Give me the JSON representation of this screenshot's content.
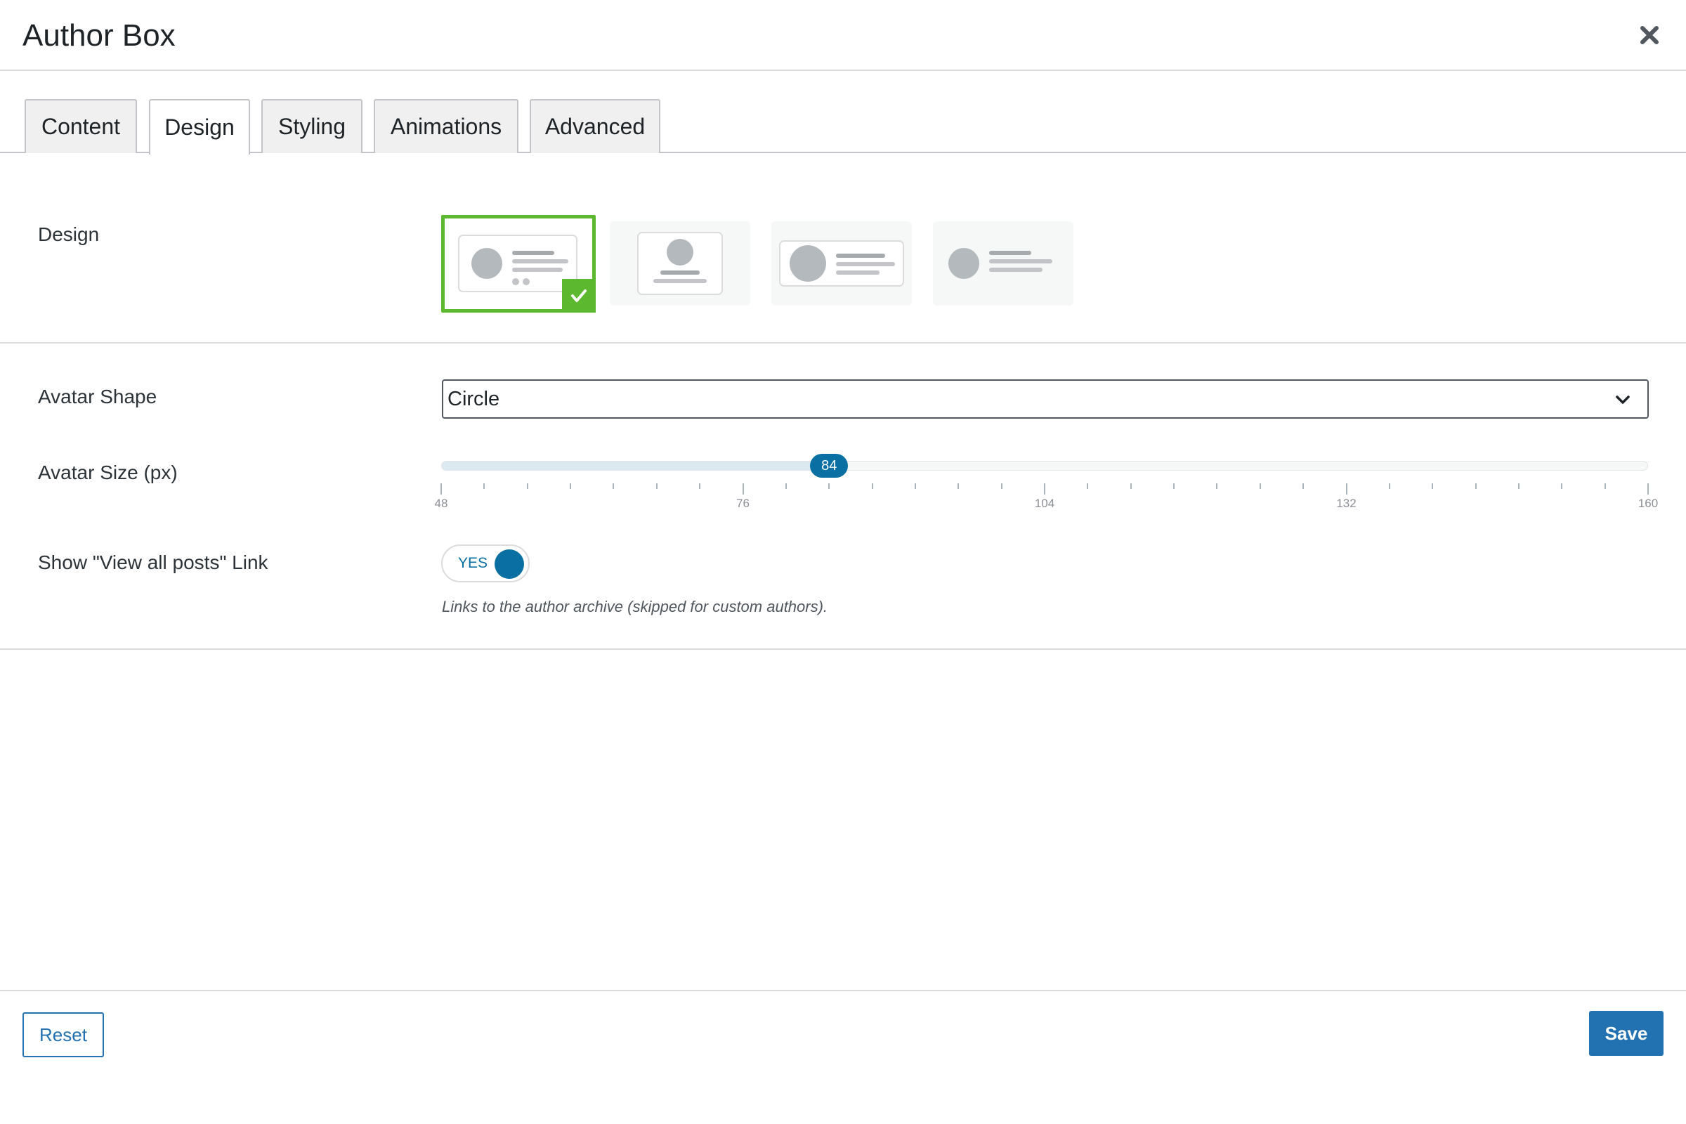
{
  "modal": {
    "title": "Author Box"
  },
  "tabs": [
    {
      "label": "Content"
    },
    {
      "label": "Design"
    },
    {
      "label": "Styling"
    },
    {
      "label": "Animations"
    },
    {
      "label": "Advanced"
    }
  ],
  "active_tab": "Design",
  "design": {
    "label": "Design",
    "options": [
      "layout-1",
      "layout-2",
      "layout-3",
      "layout-4"
    ],
    "selected_index": 0
  },
  "avatar_shape": {
    "label": "Avatar Shape",
    "value": "Circle"
  },
  "avatar_size": {
    "label": "Avatar Size (px)",
    "value": "84",
    "min": 48,
    "max": 160,
    "tick_labels": [
      "48",
      "76",
      "104",
      "132",
      "160"
    ]
  },
  "view_all_posts": {
    "label": "Show \"View all posts\" Link",
    "toggle_text": "YES",
    "help": "Links to the author archive (skipped for custom authors)."
  },
  "footer": {
    "reset_label": "Reset",
    "save_label": "Save"
  },
  "colors": {
    "accent": "#2271b1",
    "slider": "#0a6fa3",
    "selected_border": "#5cb82e",
    "placeholder_gray": "#b4b9be"
  }
}
